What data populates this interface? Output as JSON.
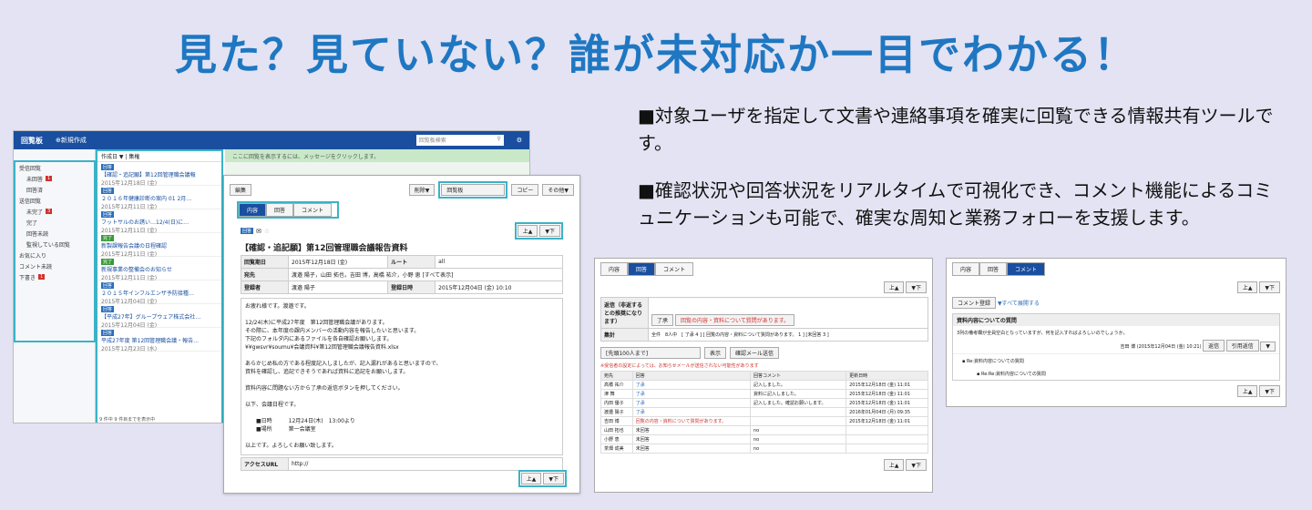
{
  "headline": "見た？見ていない？誰が未対応か一目でわかる！",
  "bullets": [
    "■対象ユーザを指定して文書や連絡事項を確実に回覧できる情報共有ツールです。",
    "■確認状況や回答状況をリアルタイムで可視化でき、コメント機能によるコミュニケーションも可能で、確実な周知と業務フォローを支援します。"
  ],
  "app": {
    "title": "回覧板",
    "new": "⊕新規作成",
    "search": "回覧板検索",
    "side": [
      {
        "l": "受信回覧",
        "c": ""
      },
      {
        "l": "未回答",
        "c": "1"
      },
      {
        "l": "回答済",
        "c": ""
      },
      {
        "l": "送信回覧",
        "c": ""
      },
      {
        "l": "未完了",
        "c": "3"
      },
      {
        "l": "完了",
        "c": ""
      },
      {
        "l": "回答未読",
        "c": ""
      },
      {
        "l": "監視している回覧",
        "c": ""
      },
      {
        "l": "お気に入り",
        "c": ""
      },
      {
        "l": "コメント未読",
        "c": ""
      },
      {
        "l": "下書き",
        "c": "1"
      }
    ],
    "list_header": "作成日 ▼ | 集権",
    "list": [
      {
        "tag": "回答",
        "t": "【確認・追記願】第12回管理職会議報",
        "d": "2015年12月18日 (金)"
      },
      {
        "tag": "回答",
        "t": "２０１６年健康診断の案内 01 2月…",
        "d": "2015年12月11日 (金)"
      },
      {
        "tag": "回答",
        "t": "フットサルのお誘い…12/4(日)に…",
        "d": "2015年12月11日 (金)"
      },
      {
        "tag": "完了",
        "t": "新製課報告会議の日程確認",
        "d": "2015年12月11日 (金)"
      },
      {
        "tag": "完了",
        "t": "新規事業の整備会のお知らせ",
        "d": "2015年12月11日 (金)"
      },
      {
        "tag": "回答",
        "t": "２０１５年インフルエンザ予防接種…",
        "d": "2015年12月04日 (金)"
      },
      {
        "tag": "回答",
        "t": "【平成27年】グループウェア株式会社…",
        "d": "2015年12月04日 (金)"
      },
      {
        "tag": "回答",
        "t": "平成27年度 第12回管理職会議・報告…",
        "d": "2015年12月23日 (水)"
      }
    ],
    "list_footer": "9 件中 9 件目までを表示中",
    "banner": "ここに回覧を表示するには、メッセージをクリックします。"
  },
  "doc": {
    "edit": "編集",
    "delete": "削除▼",
    "board": "回覧板",
    "copy": "コピー",
    "other": "その他▼",
    "tabs": [
      "内容",
      "回答",
      "コメント"
    ],
    "up": "上▲",
    "down": "▼下",
    "tag": "回答",
    "title": "【確認・追記願】第12回管理職会議報告資料",
    "meta": [
      [
        "回覧期日",
        "2015年12月18日 (金)",
        "ルート",
        "all"
      ],
      [
        "宛先",
        "渡邉 陽子，山田 拓也，吉田 博，高橋 祐介，小野 恵 [すべて表示]",
        "",
        ""
      ],
      [
        "登録者",
        "渡邉 陽子",
        "登録日時",
        "2015年12月04日 (金) 10:10"
      ]
    ],
    "body": [
      "お疲れ様です。渡邉です。",
      "",
      "12/24(木)に平成27年度　第12回管理職会議があります。",
      "その際に、本年度の課内メンバーの活動内容を報告したいと思います。",
      "下記のフォルダ内にあるファイルを各自確認お願いします。",
      "¥¥gwsvr¥soumu¥会議資料¥第12回管理職会議報告資料.xlsx",
      "",
      "あらかじめ私の方である程度記入しましたが、記入漏れがあると思いますので、",
      "資料を確認し、追記できそうであれば資料に追記をお願いします。",
      "",
      "資料内容に問題ない方から了承の返信ボタンを押してください。",
      "",
      "以下、会議日程です。",
      "",
      "　　■日時　　　12月24日(木)　13:00より",
      "　　■場所　　　第一会議室",
      "",
      "以上です。よろしくお願い致します。"
    ],
    "url_label": "アクセスURL",
    "url": "http://"
  },
  "p2": {
    "tabs": [
      "内容",
      "回答",
      "コメント"
    ],
    "reply_label": "返信（非返するとの推奨になります）",
    "agree": "了承",
    "problem": "回覧の内容・資料について質問があります。",
    "total_label": "集計",
    "total": "全件　8人中　[ 了承 4 ] [ 回覧の内容・資料について質問があります。 1 ] [未回答 3 ]",
    "filter": "[先頭100人まで]",
    "show": "表示",
    "confirm_mail": "確認メール送信",
    "warn": "※受信者の設定によっては、お知らせメールが送信されない可能性があります",
    "headers": [
      "宛先",
      "回答",
      "回答コメント",
      "更新日時"
    ],
    "rows": [
      [
        "高橋 祐介",
        "了承",
        "記入しました。",
        "2015年12月18日 (金) 11:01"
      ],
      [
        "津 舞",
        "了承",
        "資料に記入しました。",
        "2015年12月18日 (金) 11:01"
      ],
      [
        "内田 優子",
        "了承",
        "記入しました。確認お願いします。",
        "2015年12月18日 (金) 11:01"
      ],
      [
        "渡邉 陽子",
        "了承",
        "",
        "2016年01月04日 (月) 09:35"
      ],
      [
        "吉田 博",
        "回覧の内容・資料について質問があります。",
        "",
        "2015年12月18日 (金) 11:01"
      ],
      [
        "山田 拓也",
        "未回答",
        "no",
        ""
      ],
      [
        "小野 恵",
        "未回答",
        "no",
        ""
      ],
      [
        "茶畑 成美",
        "未回答",
        "no",
        ""
      ]
    ]
  },
  "p3": {
    "tabs": [
      "内容",
      "回答",
      "コメント"
    ],
    "reg": "コメント登録",
    "expand": "▼すべて展開する",
    "subject": "資料内容についての質問",
    "text": "3列の備考欄が全員空白となっていますが、何を記入すればよろしいのでしょうか。",
    "author": "吉田 博 (2015年12月04日 (金) 10:21)",
    "reply": "返信",
    "quote": "引用返信",
    "t1": "Re:資料内容についての質問",
    "t2": "Re:Re:資料内容についての質問"
  }
}
